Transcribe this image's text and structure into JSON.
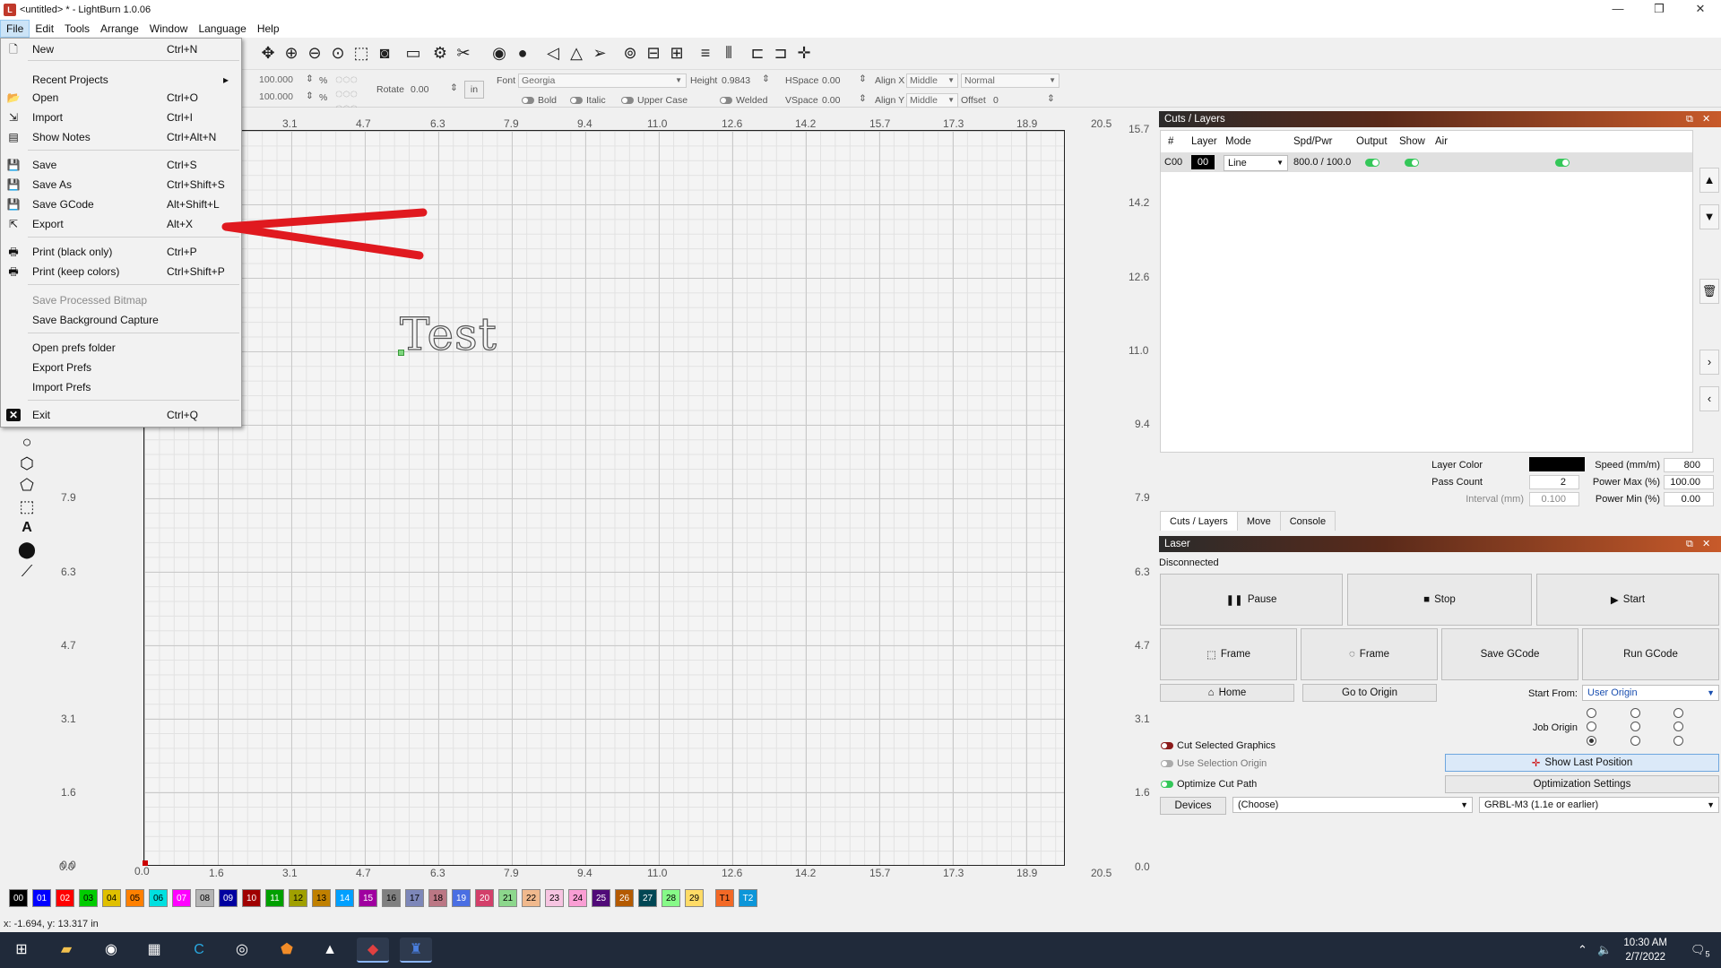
{
  "window": {
    "title": "<untitled> * - LightBurn 1.0.06",
    "minimize": "—",
    "maximize": "❒",
    "close": "✕"
  },
  "menubar": [
    "File",
    "Edit",
    "Tools",
    "Arrange",
    "Window",
    "Language",
    "Help"
  ],
  "file_menu": {
    "new": {
      "label": "New",
      "shortcut": "Ctrl+N"
    },
    "recent": {
      "label": "Recent Projects",
      "arrow": "▸"
    },
    "open": {
      "label": "Open",
      "shortcut": "Ctrl+O"
    },
    "import": {
      "label": "Import",
      "shortcut": "Ctrl+I"
    },
    "show_notes": {
      "label": "Show Notes",
      "shortcut": "Ctrl+Alt+N"
    },
    "save": {
      "label": "Save",
      "shortcut": "Ctrl+S"
    },
    "save_as": {
      "label": "Save As",
      "shortcut": "Ctrl+Shift+S"
    },
    "save_gcode": {
      "label": "Save GCode",
      "shortcut": "Alt+Shift+L"
    },
    "export": {
      "label": "Export",
      "shortcut": "Alt+X"
    },
    "print_black": {
      "label": "Print (black only)",
      "shortcut": "Ctrl+P"
    },
    "print_colors": {
      "label": "Print (keep colors)",
      "shortcut": "Ctrl+Shift+P"
    },
    "save_processed": {
      "label": "Save Processed Bitmap"
    },
    "save_background": {
      "label": "Save Background Capture"
    },
    "open_prefs": {
      "label": "Open prefs folder"
    },
    "export_prefs": {
      "label": "Export Prefs"
    },
    "import_prefs": {
      "label": "Import Prefs"
    },
    "exit": {
      "label": "Exit",
      "shortcut": "Ctrl+Q"
    }
  },
  "toolbar2": {
    "width_val": "100.000",
    "height_val": "100.000",
    "pct": "%",
    "rotate_label": "Rotate",
    "rotate_val": "0.00",
    "unit": "in",
    "font_label": "Font",
    "font_val": "Georgia",
    "height_label": "Height",
    "height_text": "0.9843",
    "hspace_label": "HSpace",
    "hspace_val": "0.00",
    "vspace_label": "VSpace",
    "vspace_val": "0.00",
    "alignx_label": "Align X",
    "alignx_val": "Middle",
    "aligny_label": "Align Y",
    "aligny_val": "Middle",
    "normal_val": "Normal",
    "offset_label": "Offset",
    "offset_val": "0",
    "bold": "Bold",
    "italic": "Italic",
    "upper": "Upper Case",
    "welded": "Welded"
  },
  "ruler_top": [
    "3.1",
    "4.7",
    "6.3",
    "7.9",
    "9.4",
    "11.0",
    "12.6",
    "14.2",
    "15.7",
    "17.3",
    "18.9",
    "20.5"
  ],
  "ruler_bottom": [
    "0.0",
    "0.0",
    "1.6",
    "3.1",
    "4.7",
    "6.3",
    "7.9",
    "9.4",
    "11.0",
    "12.6",
    "14.2",
    "15.7",
    "17.3",
    "18.9",
    "20.5"
  ],
  "ruler_right": [
    "15.7",
    "14.2",
    "12.6",
    "11.0",
    "9.4",
    "7.9",
    "6.3",
    "4.7",
    "3.1",
    "1.6",
    "0.0"
  ],
  "ruler_left": [
    "7.9",
    "6.3",
    "4.7",
    "3.1",
    "1.6",
    "0.0"
  ],
  "canvas_text": "Test",
  "cuts_panel": {
    "title": "Cuts / Layers",
    "headers": [
      "#",
      "Layer",
      "Mode",
      "Spd/Pwr",
      "Output",
      "Show",
      "Air"
    ],
    "row": {
      "num": "C00",
      "layer": "00",
      "mode": "Line",
      "spdpwr": "800.0 / 100.0"
    },
    "layer_color_label": "Layer Color",
    "speed_label": "Speed (mm/m)",
    "speed_val": "800",
    "pass_label": "Pass Count",
    "pass_val": "2",
    "pmax_label": "Power Max (%)",
    "pmax_val": "100.00",
    "interval_label": "Interval (mm)",
    "interval_val": "0.100",
    "pmin_label": "Power Min (%)",
    "pmin_val": "0.00",
    "tabs": [
      "Cuts / Layers",
      "Move",
      "Console"
    ]
  },
  "laser_panel": {
    "title": "Laser",
    "status": "Disconnected",
    "pause": "Pause",
    "stop": "Stop",
    "start": "Start",
    "frame1": "Frame",
    "frame2": "Frame",
    "save_gcode": "Save GCode",
    "run_gcode": "Run GCode",
    "home": "Home",
    "go_origin": "Go to Origin",
    "start_from_label": "Start From:",
    "start_from_val": "User Origin",
    "job_origin_label": "Job Origin",
    "cut_selected": "Cut Selected Graphics",
    "use_selection": "Use Selection Origin",
    "optimize": "Optimize Cut Path",
    "show_last": "Show Last Position",
    "opt_settings": "Optimization Settings",
    "devices": "Devices",
    "choose": "(Choose)",
    "grbl": "GRBL-M3 (1.1e or earlier)"
  },
  "palette": [
    {
      "label": "00",
      "color": "#000000",
      "fg": "#ffffff"
    },
    {
      "label": "01",
      "color": "#0000ff",
      "fg": "#ffffff"
    },
    {
      "label": "02",
      "color": "#ff0000",
      "fg": "#ffffff"
    },
    {
      "label": "03",
      "color": "#00cc00",
      "fg": "#000000"
    },
    {
      "label": "04",
      "color": "#e0c000",
      "fg": "#000000"
    },
    {
      "label": "05",
      "color": "#ff8000",
      "fg": "#000000"
    },
    {
      "label": "06",
      "color": "#00e0e0",
      "fg": "#000000"
    },
    {
      "label": "07",
      "color": "#ff00ff",
      "fg": "#ffffff"
    },
    {
      "label": "08",
      "color": "#b4b4b4",
      "fg": "#000000"
    },
    {
      "label": "09",
      "color": "#0000a0",
      "fg": "#ffffff"
    },
    {
      "label": "10",
      "color": "#a00000",
      "fg": "#ffffff"
    },
    {
      "label": "11",
      "color": "#00a000",
      "fg": "#ffffff"
    },
    {
      "label": "12",
      "color": "#a0a000",
      "fg": "#000000"
    },
    {
      "label": "13",
      "color": "#c08000",
      "fg": "#000000"
    },
    {
      "label": "14",
      "color": "#00a0ff",
      "fg": "#ffffff"
    },
    {
      "label": "15",
      "color": "#a000a0",
      "fg": "#ffffff"
    },
    {
      "label": "16",
      "color": "#808080",
      "fg": "#000000"
    },
    {
      "label": "17",
      "color": "#7d87b9",
      "fg": "#000000"
    },
    {
      "label": "18",
      "color": "#bb7784",
      "fg": "#000000"
    },
    {
      "label": "19",
      "color": "#4a6fe3",
      "fg": "#ffffff"
    },
    {
      "label": "20",
      "color": "#d33f6a",
      "fg": "#ffffff"
    },
    {
      "label": "21",
      "color": "#8cd78c",
      "fg": "#000000"
    },
    {
      "label": "22",
      "color": "#f0b98d",
      "fg": "#000000"
    },
    {
      "label": "23",
      "color": "#f6c4e1",
      "fg": "#000000"
    },
    {
      "label": "24",
      "color": "#fa9ed4",
      "fg": "#000000"
    },
    {
      "label": "25",
      "color": "#500a78",
      "fg": "#ffffff"
    },
    {
      "label": "26",
      "color": "#b45a00",
      "fg": "#ffffff"
    },
    {
      "label": "27",
      "color": "#004754",
      "fg": "#ffffff"
    },
    {
      "label": "28",
      "color": "#86fa88",
      "fg": "#000000"
    },
    {
      "label": "29",
      "color": "#ffdb66",
      "fg": "#000000"
    },
    {
      "label": "T1",
      "color": "#f36926",
      "fg": "#000000"
    },
    {
      "label": "T2",
      "color": "#0c96d9",
      "fg": "#ffffff"
    }
  ],
  "status": "x: -1.694, y: 13.317 in",
  "taskbar": {
    "time": "10:30 AM",
    "date": "2/7/2022",
    "notif": "5"
  }
}
